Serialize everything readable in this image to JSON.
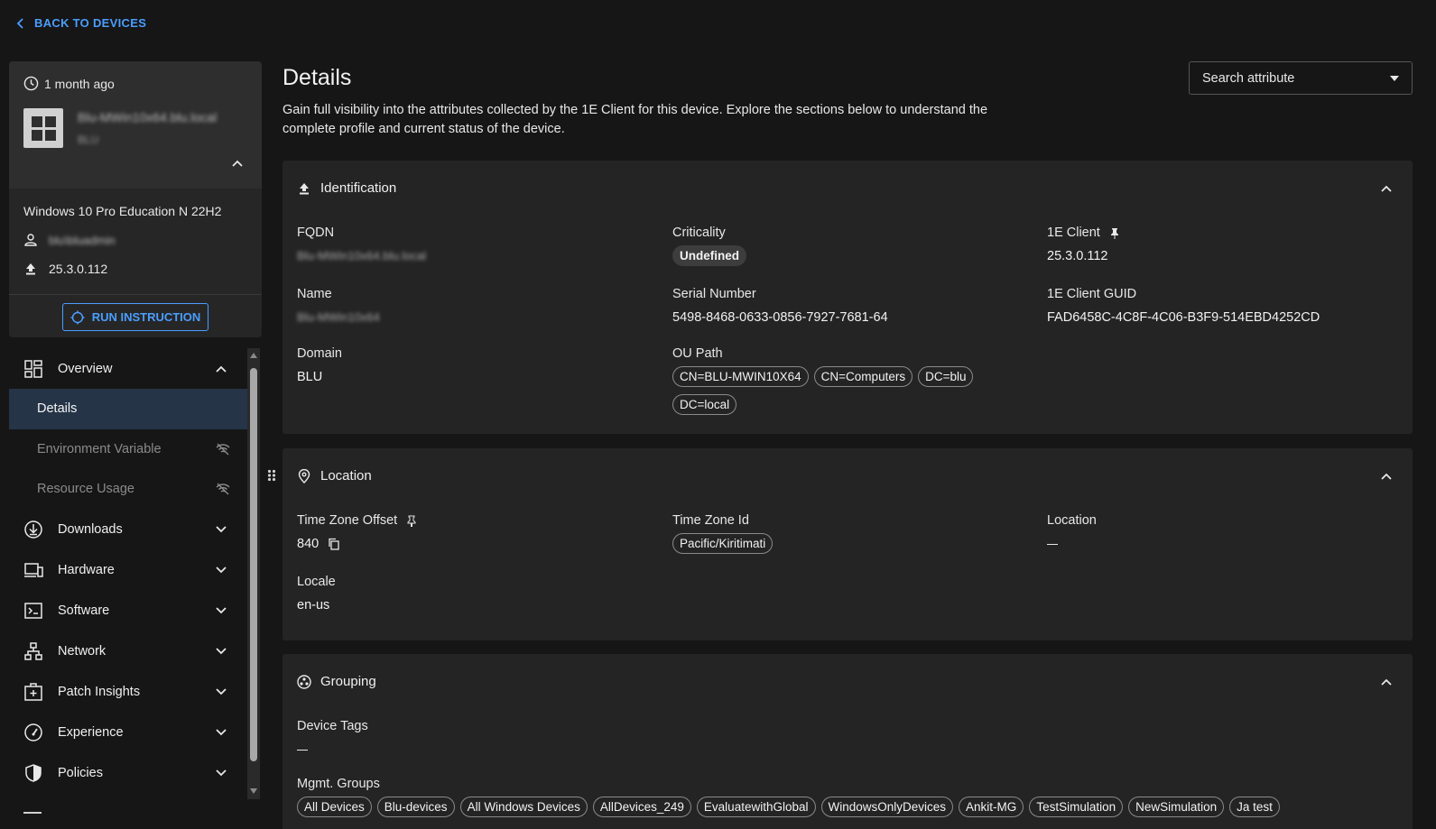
{
  "back_label": "BACK TO DEVICES",
  "device": {
    "last_seen": "1 month ago",
    "name": "Blu-MWin10x64.blu.local",
    "domain": "BLU",
    "os": "Windows 10 Pro Education N 22H2",
    "user": "blu\\bluadmin",
    "client_version": "25.3.0.112",
    "run_label": "RUN INSTRUCTION"
  },
  "nav": {
    "overview": "Overview",
    "details": "Details",
    "environment_variable": "Environment Variable",
    "resource_usage": "Resource Usage",
    "downloads": "Downloads",
    "hardware": "Hardware",
    "software": "Software",
    "network": "Network",
    "patch_insights": "Patch Insights",
    "experience": "Experience",
    "policies": "Policies"
  },
  "main": {
    "title": "Details",
    "description": "Gain full visibility into the attributes collected by the 1E Client for this device. Explore the sections below to understand the complete profile and current status of the device.",
    "search_placeholder": "Search attribute"
  },
  "identification": {
    "title": "Identification",
    "fqdn_label": "FQDN",
    "fqdn": "Blu-MWin10x64.blu.local",
    "criticality_label": "Criticality",
    "criticality": "Undefined",
    "client_label": "1E Client",
    "client": "25.3.0.112",
    "name_label": "Name",
    "name": "Blu-MWin10x64",
    "serial_label": "Serial Number",
    "serial": "5498-8468-0633-0856-7927-7681-64",
    "guid_label": "1E Client GUID",
    "guid": "FAD6458C-4C8F-4C06-B3F9-514EBD4252CD",
    "domain_label": "Domain",
    "domain": "BLU",
    "ou_label": "OU Path",
    "ou_path": [
      "CN=BLU-MWIN10X64",
      "CN=Computers",
      "DC=blu",
      "DC=local"
    ]
  },
  "location": {
    "title": "Location",
    "tz_offset_label": "Time Zone Offset",
    "tz_offset": "840",
    "tz_id_label": "Time Zone Id",
    "tz_id": "Pacific/Kiritimati",
    "location_label": "Location",
    "locale_label": "Locale",
    "locale": "en-us"
  },
  "grouping": {
    "title": "Grouping",
    "tags_label": "Device Tags",
    "mgmt_label": "Mgmt. Groups",
    "mgmt_groups": [
      "All Devices",
      "Blu-devices",
      "All Windows Devices",
      "AllDevices_249",
      "EvaluatewithGlobal",
      "WindowsOnlyDevices",
      "Ankit-MG",
      "TestSimulation",
      "NewSimulation",
      "Ja test"
    ]
  },
  "colors": {
    "accent": "#4a9eff",
    "background": "#161616",
    "card": "#242424",
    "active_nav": "#253447"
  }
}
